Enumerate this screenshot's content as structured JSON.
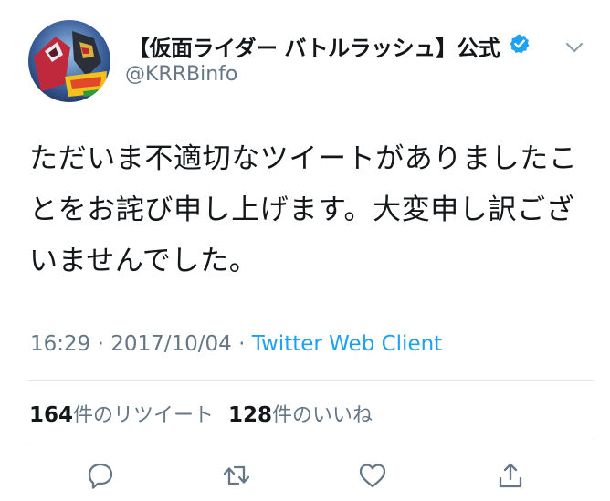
{
  "user": {
    "display_name": "【仮面ライダー バトルラッシュ】公式",
    "handle": "@KRRBinfo"
  },
  "tweet": {
    "text": "ただいま不適切なツイートがありましたことをお詫び申し上げます。大変申し訳ございませんでした。",
    "time": "16:29",
    "separator": " · ",
    "date": "2017/10/04",
    "source": "Twitter Web Client"
  },
  "stats": {
    "retweets_count": "164",
    "retweets_label": "件のリツイート",
    "likes_count": "128",
    "likes_label": "件のいいね"
  },
  "icons": {
    "verified": "verified-badge-icon",
    "more": "chevron-down-icon",
    "reply": "reply-icon",
    "retweet": "retweet-icon",
    "like": "heart-icon",
    "share": "share-icon"
  },
  "colors": {
    "text": "#14171a",
    "secondary": "#657786",
    "accent": "#1da1f2",
    "divider": "#e1e8ed"
  }
}
